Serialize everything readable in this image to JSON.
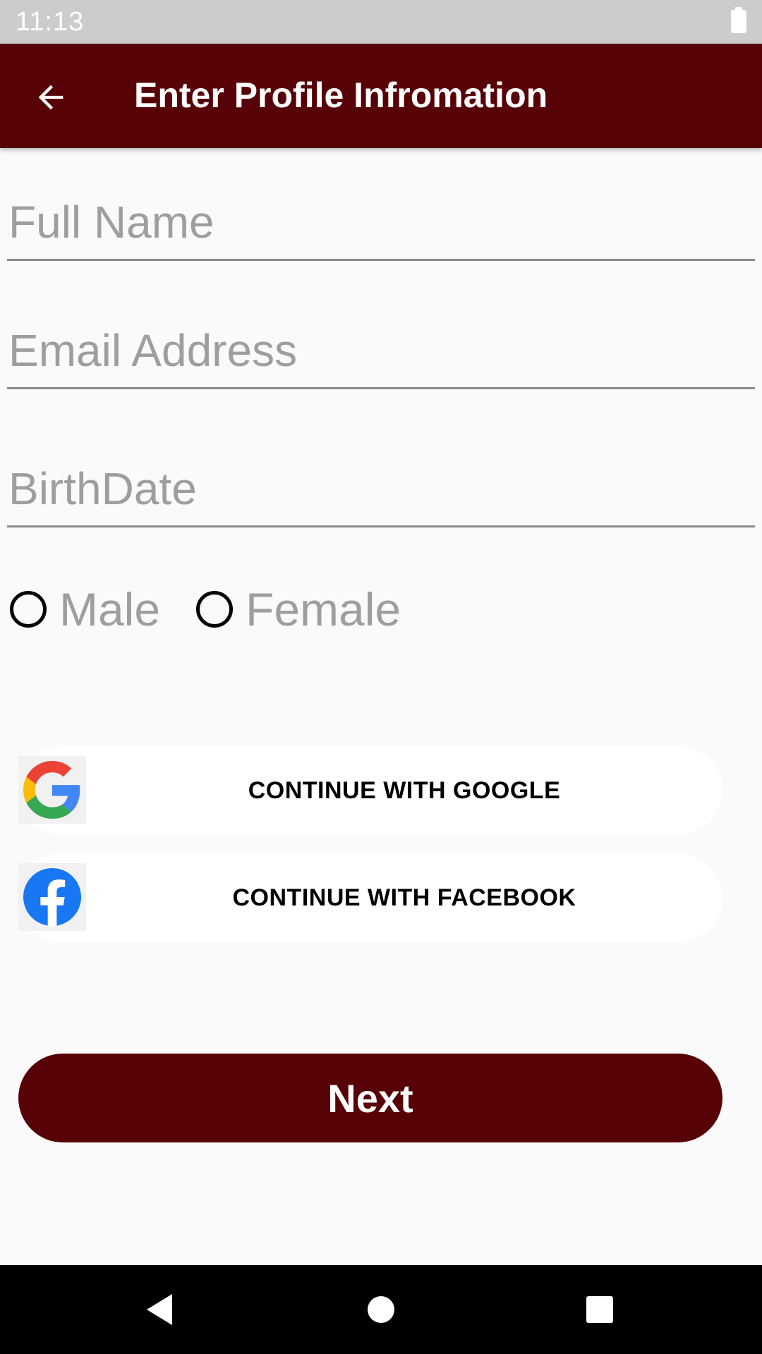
{
  "status_bar": {
    "time": "11:13",
    "battery_icon": "battery-full-icon"
  },
  "app_bar": {
    "title": "Enter Profile Infromation",
    "back_icon": "arrow-left-icon",
    "color": "#570206"
  },
  "form": {
    "full_name": {
      "value": "",
      "placeholder": "Full Name"
    },
    "email": {
      "value": "",
      "placeholder": "Email Address"
    },
    "birthdate": {
      "value": "",
      "placeholder": "BirthDate"
    },
    "gender": {
      "options": [
        {
          "label": "Male",
          "checked": false
        },
        {
          "label": "Female",
          "checked": false
        }
      ]
    }
  },
  "social": {
    "google_label": "CONTINUE WITH GOOGLE",
    "google_icon": "google-logo-icon",
    "facebook_label": "CONTINUE WITH FACEBOOK",
    "facebook_icon": "facebook-logo-icon"
  },
  "next_button": {
    "label": "Next",
    "color": "#570206"
  },
  "nav_bar": {
    "back_icon": "nav-back-icon",
    "home_icon": "nav-home-icon",
    "recents_icon": "nav-recents-icon"
  }
}
